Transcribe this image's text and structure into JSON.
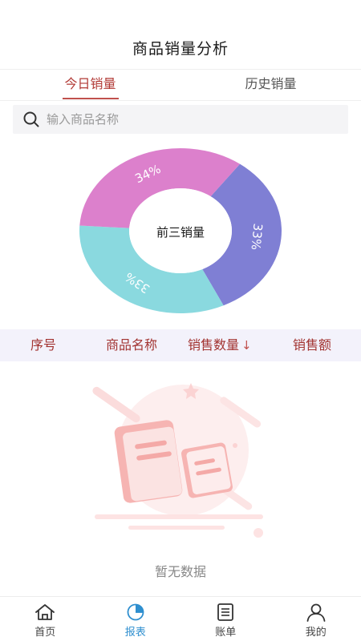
{
  "header": {
    "title": "商品销量分析"
  },
  "tabs": [
    {
      "label": "今日销量",
      "active": true
    },
    {
      "label": "历史销量",
      "active": false
    }
  ],
  "search": {
    "placeholder": "输入商品名称",
    "value": "",
    "icon": "search-icon"
  },
  "donut": {
    "center_label": "前三销量",
    "segments": [
      {
        "label": "34%",
        "value": 34,
        "color": "#dc80cc"
      },
      {
        "label": "33%",
        "value": 33,
        "color": "#7f7fd4"
      },
      {
        "label": "33%",
        "value": 33,
        "color": "#8ad9df"
      }
    ]
  },
  "table": {
    "headers": [
      "序号",
      "商品名称",
      "销售数量",
      "销售额"
    ],
    "sort_indicator": "↓",
    "rows": []
  },
  "empty": {
    "text": "暂无数据"
  },
  "bottom_nav": {
    "items": [
      {
        "label": "首页",
        "icon": "home-icon",
        "active": false
      },
      {
        "label": "报表",
        "icon": "report-icon",
        "active": true
      },
      {
        "label": "账单",
        "icon": "bill-icon",
        "active": false
      },
      {
        "label": "我的",
        "icon": "profile-icon",
        "active": false
      }
    ]
  },
  "colors": {
    "accent": "#c0504d",
    "nav_active": "#2f8fcf",
    "header_bg": "#f3f2fb"
  }
}
